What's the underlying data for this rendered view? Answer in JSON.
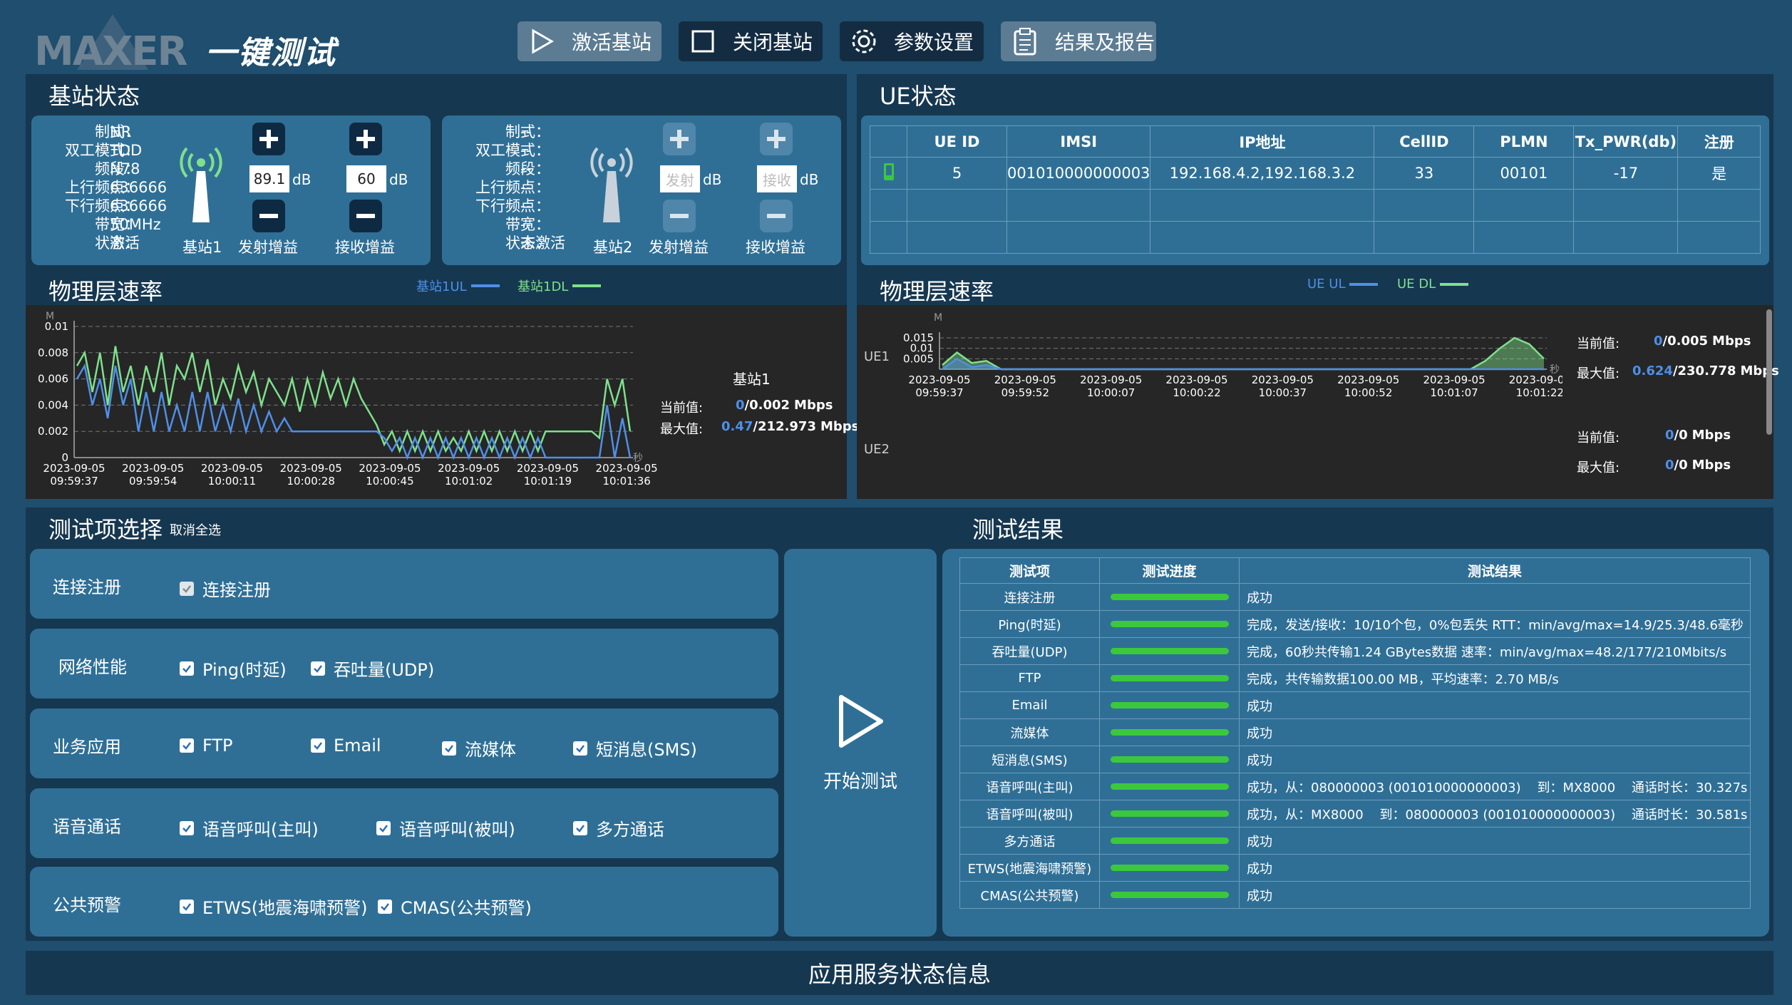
{
  "header": {
    "logo_text": "MAXER",
    "app_title": "一键测试",
    "buttons": [
      {
        "label": "激活基站",
        "icon": "play-icon"
      },
      {
        "label": "关闭基站",
        "icon": "square-icon"
      },
      {
        "label": "参数设置",
        "icon": "gear-icon"
      },
      {
        "label": "结果及报告",
        "icon": "clipboard-icon"
      }
    ]
  },
  "bs_status": {
    "title": "基站状态",
    "bs1": {
      "labels": [
        "制式：",
        "双工模式：",
        "频段：",
        "上行频点：",
        "下行频点：",
        "带宽：",
        "状态："
      ],
      "values": [
        "NR",
        "TDD",
        "N78",
        "636666",
        "636666",
        "50MHz",
        "激活"
      ],
      "name": "基站1",
      "tx_gain": "89.1",
      "rx_gain": "60",
      "unit": "dB",
      "tx_label": "发射增益",
      "rx_label": "接收增益"
    },
    "bs2": {
      "labels": [
        "制式：",
        "双工模式：",
        "频段：",
        "上行频点：",
        "下行频点：",
        "带宽：",
        "状态："
      ],
      "values": [
        "--",
        "--",
        "--",
        "--",
        "--",
        "--",
        "未激活"
      ],
      "name": "基站2",
      "tx_placeholder": "发射",
      "rx_placeholder": "接收",
      "unit": "dB",
      "tx_label": "发射增益",
      "rx_label": "接收增益"
    }
  },
  "ue_status": {
    "title": "UE状态",
    "columns": [
      "",
      "UE ID",
      "IMSI",
      "IP地址",
      "CellID",
      "PLMN",
      "Tx_PWR(db)",
      "注册"
    ],
    "rows": [
      {
        "ue_id": "5",
        "imsi": "001010000000003",
        "ip": "192.168.4.2,192.168.3.2",
        "cellid": "33",
        "plmn": "00101",
        "tx_pwr": "-17",
        "reg": "是"
      }
    ]
  },
  "phy_bs": {
    "title": "物理层速率",
    "legend_ul": "基站1UL",
    "legend_dl": "基站1DL",
    "unit_m": "M",
    "unit_s": "秒",
    "bs_name": "基站1",
    "current_label": "当前值:",
    "current_ul": "0",
    "current_dl": "/0.002",
    "max_label": "最大值:",
    "max_ul": "0.47",
    "max_dl": "/212.973",
    "mbps": "Mbps"
  },
  "phy_ue": {
    "title": "物理层速率",
    "legend_ul": "UE UL",
    "legend_dl": "UE DL",
    "unit_m": "M",
    "unit_s": "秒",
    "ue1": "UE1",
    "ue2": "UE2",
    "current_label": "当前值:",
    "max_label": "最大值:",
    "ue1_current_ul": "0",
    "ue1_current_dl": "/0.005",
    "ue1_max_ul": "0.624",
    "ue1_max_dl": "/230.778",
    "ue2_current_ul": "0",
    "ue2_current_dl": "/0",
    "ue2_max_ul": "0",
    "ue2_max_dl": "/0",
    "mbps": "Mbps"
  },
  "chart_data": [
    {
      "type": "line",
      "ylim": [
        0,
        0.01
      ],
      "yticks": [
        "0",
        "0.002",
        "0.004",
        "0.006",
        "0.008",
        "0.01"
      ],
      "x": [
        "2023-09-05 09:59:37",
        "2023-09-05 09:59:54",
        "2023-09-05 10:00:11",
        "2023-09-05 10:00:28",
        "2023-09-05 10:00:45",
        "2023-09-05 10:01:02",
        "2023-09-05 10:01:19",
        "2023-09-05 10:01:36"
      ],
      "series": [
        {
          "name": "基站1DL",
          "color": "#7fe08c",
          "values": [
            0.007,
            0.008,
            0.005,
            0.008,
            0.004,
            0.0085,
            0.005,
            0.007,
            0.004,
            0.007,
            0.005,
            0.008,
            0.004,
            0.007,
            0.006,
            0.008,
            0.005,
            0.0075,
            0.004,
            0.006,
            0.0045,
            0.007,
            0.005,
            0.0065,
            0.004,
            0.006,
            0.005,
            0.004,
            0.006,
            0.0035,
            0.006,
            0.004,
            0.0065,
            0.0045,
            0.006,
            0.004,
            0.006,
            0.0045,
            0.0035,
            0.0025,
            0.001,
            0.002,
            0.0005,
            0.002,
            0.0005,
            0.002,
            0.0005,
            0.002,
            0.0005,
            0.0015,
            0.0005,
            0.002,
            0.0005,
            0.002,
            0.0005,
            0.002,
            0.0005,
            0.002,
            0.0005,
            0.002,
            0.0005,
            0.002,
            0.002,
            0.002,
            0.002,
            0.002,
            0.002,
            0.002,
            0.0015,
            0.006,
            0.004,
            0.006,
            0.002
          ]
        },
        {
          "name": "基站1UL",
          "color": "#4f8fe8",
          "values": [
            0.006,
            0.007,
            0.004,
            0.006,
            0.003,
            0.007,
            0.004,
            0.006,
            0.002,
            0.005,
            0.002,
            0.005,
            0.002,
            0.004,
            0.002,
            0.005,
            0.002,
            0.005,
            0.002,
            0.004,
            0.002,
            0.0045,
            0.002,
            0.004,
            0.002,
            0.0035,
            0.002,
            0.003,
            0.002,
            0.002,
            0.002,
            0.002,
            0.002,
            0.002,
            0.002,
            0.002,
            0.002,
            0.002,
            0.002,
            0.002,
            0.0015,
            0.0005,
            0.0015,
            0.0,
            0.0015,
            0.0,
            0.0015,
            0.0,
            0.0015,
            0.0,
            0.0015,
            0.0,
            0.0015,
            0.0,
            0.0015,
            0.0,
            0.0015,
            0.0,
            0.0015,
            0.0,
            0.0015,
            0.0,
            0.0,
            0.0,
            0.0,
            0.0,
            0.0,
            0.0,
            0.0,
            0.004,
            0.0,
            0.003,
            0.0
          ]
        }
      ]
    },
    {
      "type": "line",
      "ylim": [
        0,
        0.015
      ],
      "yticks": [
        "0.005",
        "0.01",
        "0.015"
      ],
      "x": [
        "2023-09-05 09:59:37",
        "2023-09-05 09:59:52",
        "2023-09-05 10:00:07",
        "2023-09-05 10:00:22",
        "2023-09-05 10:00:37",
        "2023-09-05 10:00:52",
        "2023-09-05 10:01:07",
        "2023-09-05 10:01:22"
      ],
      "series": [
        {
          "name": "UE DL",
          "color": "#7fe08c",
          "values": [
            0.002,
            0.008,
            0.003,
            0.004,
            0.0,
            0.0,
            0.0,
            0.0,
            0.0,
            0.0,
            0.0,
            0.0,
            0.0,
            0.0,
            0.0,
            0.0,
            0.0,
            0.0,
            0.0,
            0.0,
            0.0,
            0.0,
            0.0,
            0.0,
            0.0,
            0.0,
            0.0,
            0.0,
            0.0,
            0.0,
            0.0,
            0.0,
            0.0,
            0.0,
            0.0,
            0.0,
            0.0,
            0.004,
            0.01,
            0.015,
            0.012,
            0.005
          ]
        },
        {
          "name": "UE UL",
          "color": "#4f8fe8",
          "values": [
            0.0,
            0.005,
            0.001,
            0.002,
            0.0,
            0.0,
            0.0,
            0.0,
            0.0,
            0.0,
            0.0,
            0.0,
            0.0,
            0.0,
            0.0,
            0.0,
            0.0,
            0.0,
            0.0,
            0.0,
            0.0,
            0.0,
            0.0,
            0.0,
            0.0,
            0.0,
            0.0,
            0.0,
            0.0,
            0.0,
            0.0,
            0.0,
            0.0,
            0.0,
            0.0,
            0.0,
            0.0,
            0.0,
            0.0,
            0.0,
            0.0,
            0.0
          ]
        }
      ]
    }
  ],
  "test_select": {
    "title": "测试项选择",
    "deselect_all": "取消全选",
    "rows": [
      {
        "label": "连接注册",
        "items": [
          "连接注册"
        ]
      },
      {
        "label": "网络性能",
        "items": [
          "Ping(时延)",
          "吞吐量(UDP)"
        ]
      },
      {
        "label": "业务应用",
        "items": [
          "FTP",
          "Email",
          "流媒体",
          "短消息(SMS)"
        ]
      },
      {
        "label": "语音通话",
        "items": [
          "语音呼叫(主叫)",
          "语音呼叫(被叫)",
          "多方通话"
        ]
      },
      {
        "label": "公共预警",
        "items": [
          "ETWS(地震海啸预警)",
          "CMAS(公共预警)"
        ]
      }
    ],
    "start_label": "开始测试"
  },
  "results": {
    "title": "测试结果",
    "columns": [
      "测试项",
      "测试进度",
      "测试结果"
    ],
    "rows": [
      {
        "item": "连接注册",
        "progress": 1.0,
        "result": "成功"
      },
      {
        "item": "Ping(时延)",
        "progress": 1.0,
        "result": "完成，发送/接收：10/10个包，0%包丢失 RTT：min/avg/max=14.9/25.3/48.6毫秒"
      },
      {
        "item": "吞吐量(UDP)",
        "progress": 1.0,
        "result": "完成，60秒共传输1.24 GBytes数据 速率：min/avg/max=48.2/177/210Mbits/s"
      },
      {
        "item": "FTP",
        "progress": 1.0,
        "result": "完成，共传输数据100.00 MB，平均速率：2.70 MB/s"
      },
      {
        "item": "Email",
        "progress": 1.0,
        "result": "成功"
      },
      {
        "item": "流媒体",
        "progress": 1.0,
        "result": "成功"
      },
      {
        "item": "短消息(SMS)",
        "progress": 1.0,
        "result": "成功"
      },
      {
        "item": "语音呼叫(主叫)",
        "progress": 1.0,
        "result": "成功，从：080000003 (001010000000003)    到：MX8000    通话时长：30.327s"
      },
      {
        "item": "语音呼叫(被叫)",
        "progress": 1.0,
        "result": "成功，从：MX8000    到：080000003 (001010000000003)    通话时长：30.581s"
      },
      {
        "item": "多方通话",
        "progress": 1.0,
        "result": "成功"
      },
      {
        "item": "ETWS(地震海啸预警)",
        "progress": 1.0,
        "result": "成功"
      },
      {
        "item": "CMAS(公共预警)",
        "progress": 1.0,
        "result": "成功"
      }
    ]
  },
  "footer": {
    "title": "应用服务状态信息"
  },
  "colors": {
    "bg": "#1f4e6e",
    "panel": "#163750",
    "sub": "#2f6f96",
    "ul": "#4f8fe8",
    "dl": "#7fe08c",
    "progress": "#3cc83c"
  }
}
